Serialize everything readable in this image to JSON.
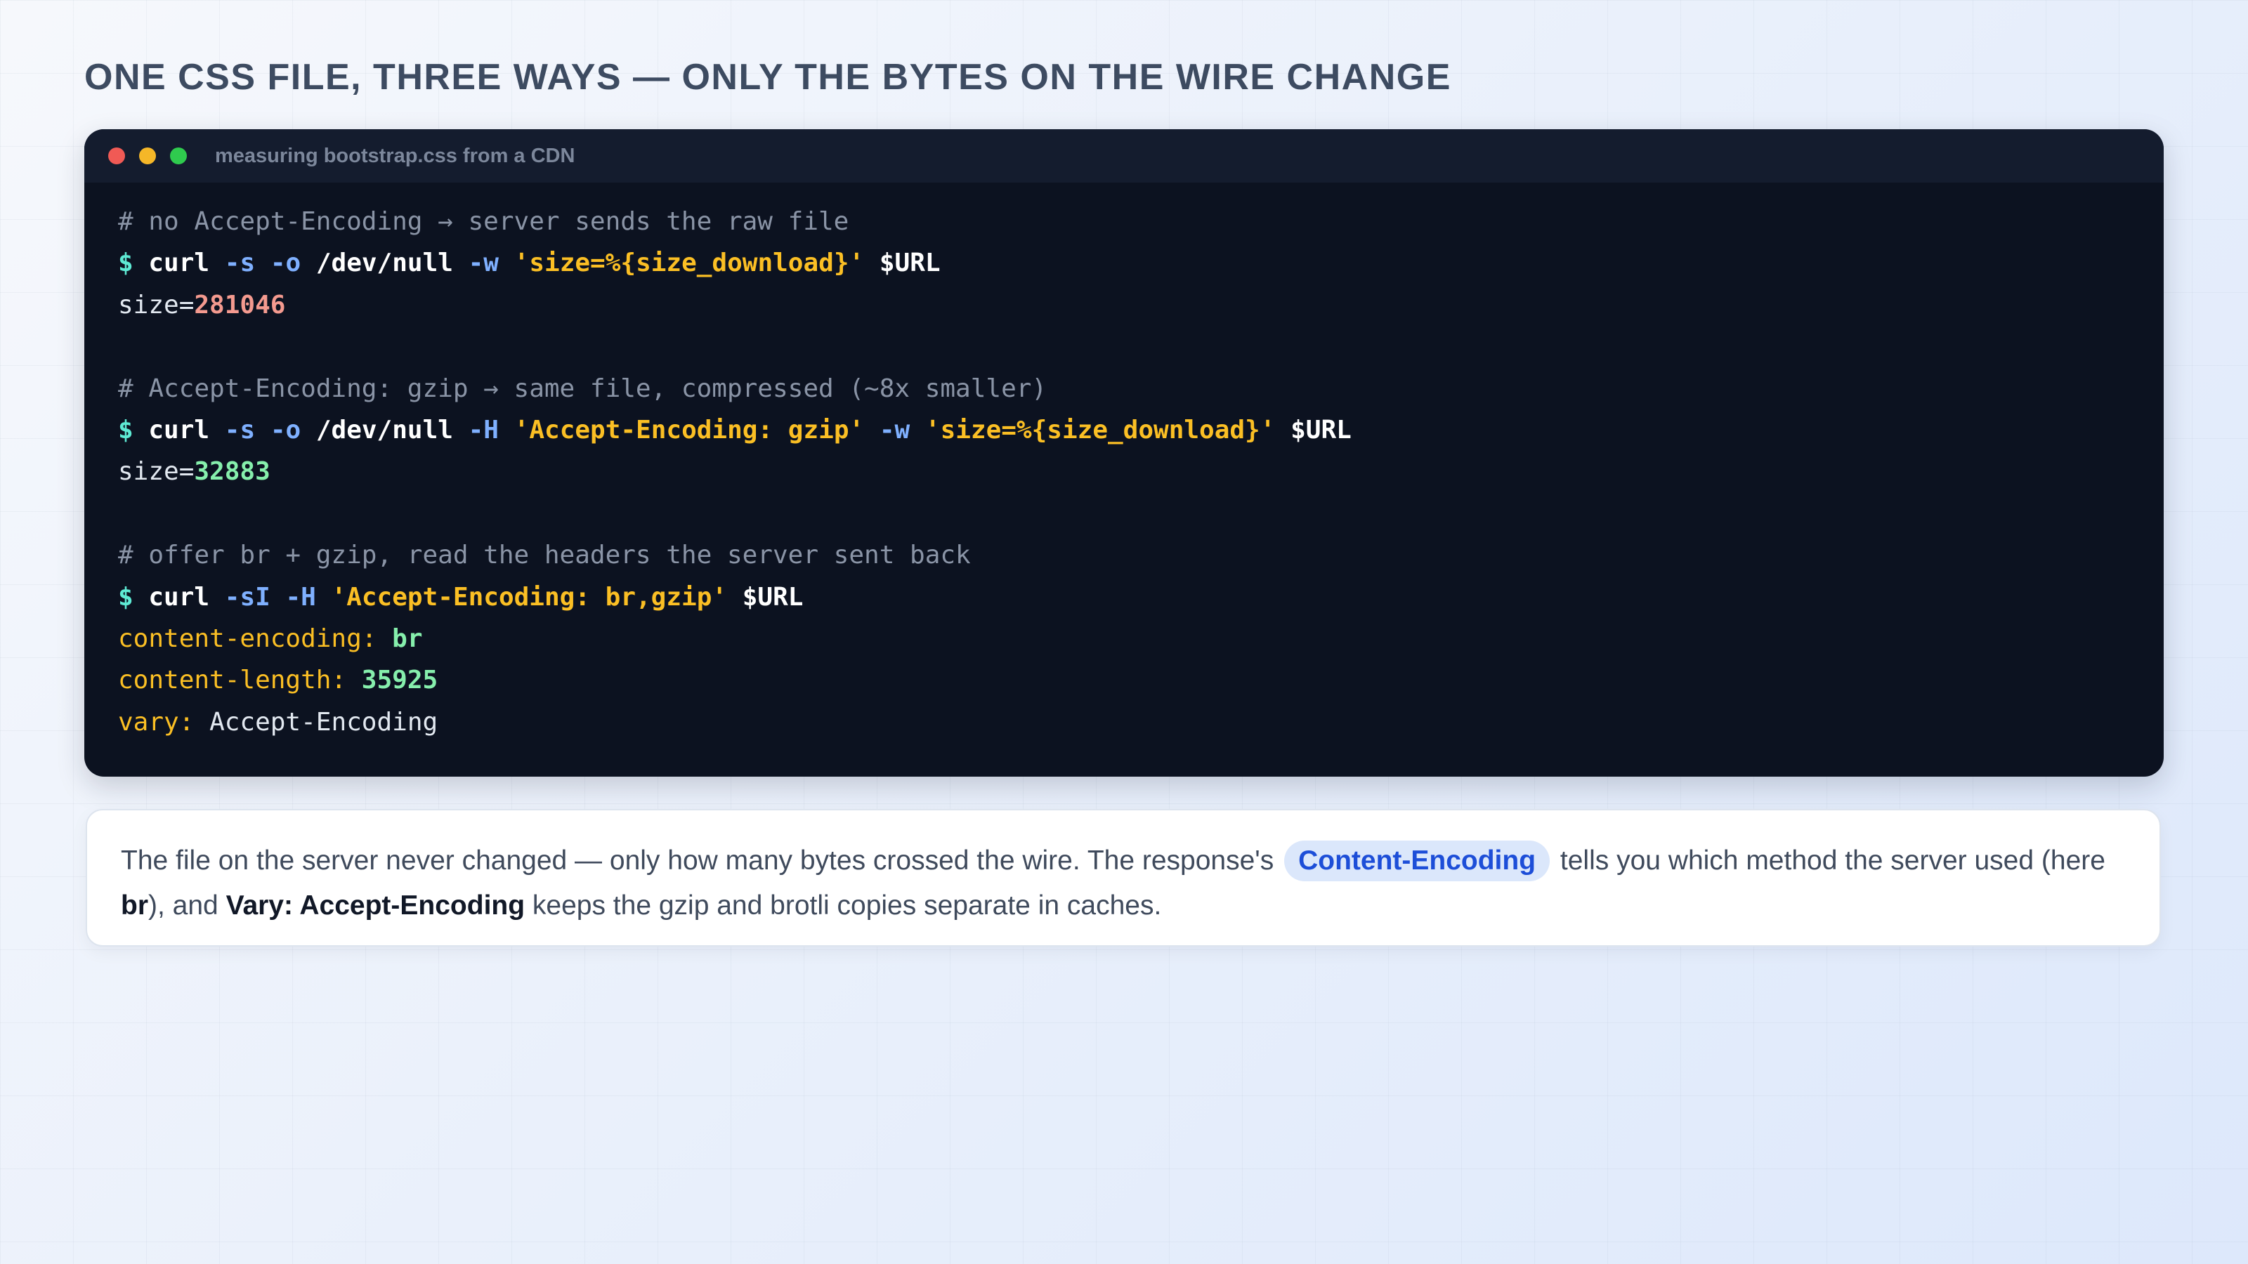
{
  "title": "ONE CSS FILE, THREE WAYS — ONLY THE BYTES ON THE WIRE CHANGE",
  "terminal": {
    "window_title": "measuring bootstrap.css from a CDN",
    "prompt": "$",
    "block1": {
      "comment": "# no Accept-Encoding → server sends the raw file",
      "cmd": "curl",
      "flag1": "-s",
      "flag2": "-o",
      "path": "/dev/null",
      "flag3": "-w",
      "format": "'size=%{size_download}'",
      "var": "$URL",
      "out_label": "size=",
      "out_value": "281046"
    },
    "block2": {
      "comment": "# Accept-Encoding: gzip → same file, compressed (~8x smaller)",
      "cmd": "curl",
      "flag1": "-s",
      "flag2": "-o",
      "path": "/dev/null",
      "flag3": "-H",
      "header": "'Accept-Encoding: gzip'",
      "flag4": "-w",
      "format": "'size=%{size_download}'",
      "var": "$URL",
      "out_label": "size=",
      "out_value": "32883"
    },
    "block3": {
      "comment": "# offer br + gzip, read the headers the server sent back",
      "cmd": "curl",
      "flag1": "-sI",
      "flag2": "-H",
      "header": "'Accept-Encoding: br,gzip'",
      "var": "$URL",
      "h1_key": "content-encoding:",
      "h1_val": "br",
      "h2_key": "content-length:",
      "h2_val": "35925",
      "h3_key": "vary:",
      "h3_val": "Accept-Encoding"
    }
  },
  "note": {
    "part1": "The file on the server never changed — only how many bytes crossed the wire. The response's",
    "pill": "Content-Encoding",
    "part2": "tells you which method the server used (here",
    "br": "br",
    "part3": "), and",
    "vary": "Vary: Accept-Encoding",
    "part4": "keeps the gzip and brotli copies separate in caches."
  }
}
